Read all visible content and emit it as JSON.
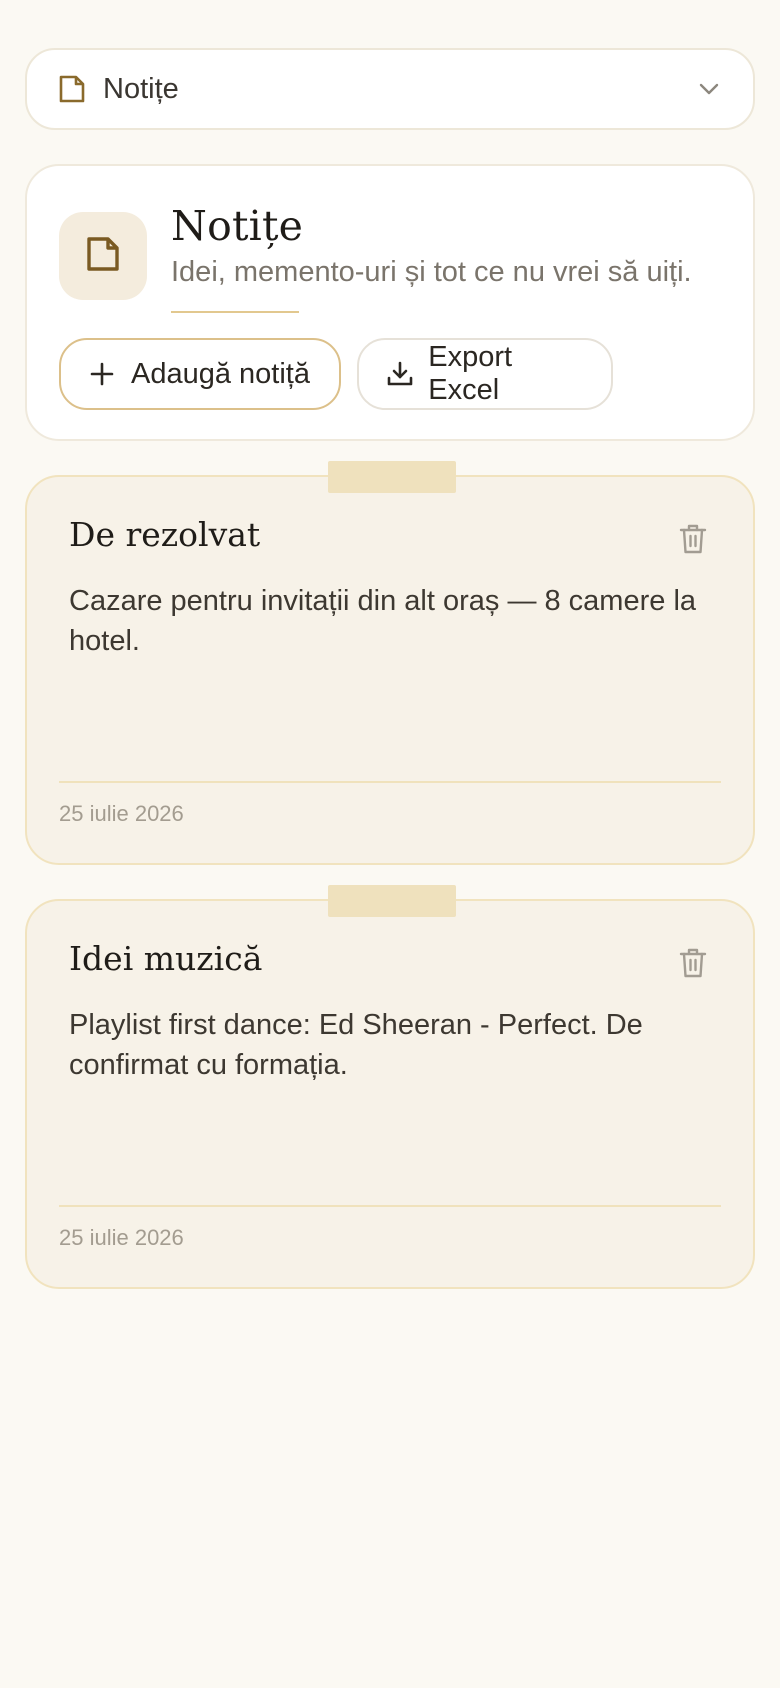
{
  "section_selector": {
    "icon": "note-icon",
    "label": "Notițe",
    "chevron": "chevron-down-icon"
  },
  "header": {
    "icon": "note-icon",
    "title": "Notițe",
    "subtitle": "Idei, memento-uri și tot ce nu vrei să uiți.",
    "add_button": {
      "icon": "plus-icon",
      "label": "Adaugă notiță"
    },
    "export_button": {
      "icon": "download-icon",
      "label": "Export Excel"
    }
  },
  "notes": [
    {
      "title": "De rezolvat",
      "body": "Cazare pentru invitații din alt oraș — 8 camere la hotel.",
      "date": "25 iulie 2026",
      "delete_icon": "trash-icon"
    },
    {
      "title": "Idei muzică",
      "body": "Playlist first dance: Ed Sheeran - Perfect. De confirmat cu formația.",
      "date": "25 iulie 2026",
      "delete_icon": "trash-icon"
    }
  ],
  "colors": {
    "background": "#fbf9f3",
    "accent": "#8a6a2c",
    "note_background": "#f7f2e8",
    "note_tape": "#efe1bd"
  }
}
